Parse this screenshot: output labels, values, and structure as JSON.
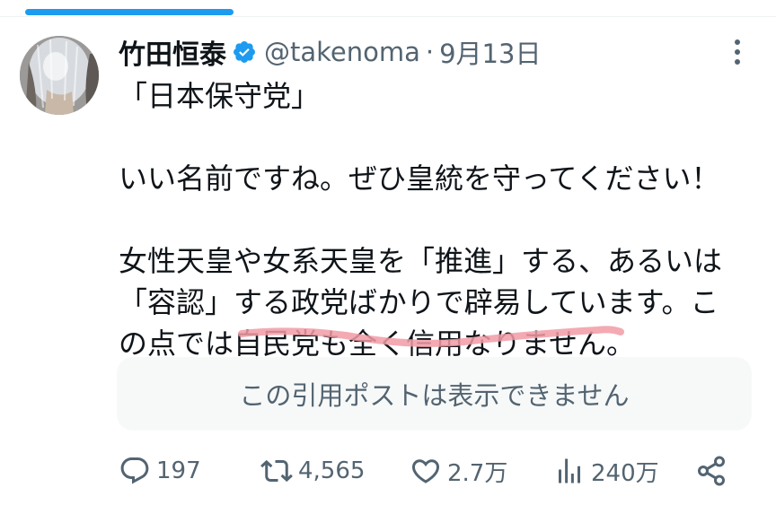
{
  "tweet": {
    "display_name": "竹田恒泰",
    "handle": "@takenoma",
    "separator": "·",
    "date": "9月13日",
    "text_lines": [
      "「日本保守党」",
      "",
      "いい名前ですね。ぜひ皇統を守ってください！",
      "",
      "女性天皇や女系天皇を「推進」する、あるいは",
      "「容認」する政党ばかりで辟易しています。こ",
      "の点では自民党も全く信用なりません。"
    ],
    "quote_unavailable": "この引用ポストは表示できません"
  },
  "actions": {
    "replies": "197",
    "reposts": "4,565",
    "likes": "2.7万",
    "views": "240万"
  },
  "colors": {
    "accent": "#1d9bf0",
    "secondary_text": "#536471",
    "highlight": "#f29ba6"
  },
  "icons": [
    "verified-badge-icon",
    "more-icon",
    "reply-icon",
    "repost-icon",
    "like-icon",
    "views-icon",
    "share-icon"
  ]
}
